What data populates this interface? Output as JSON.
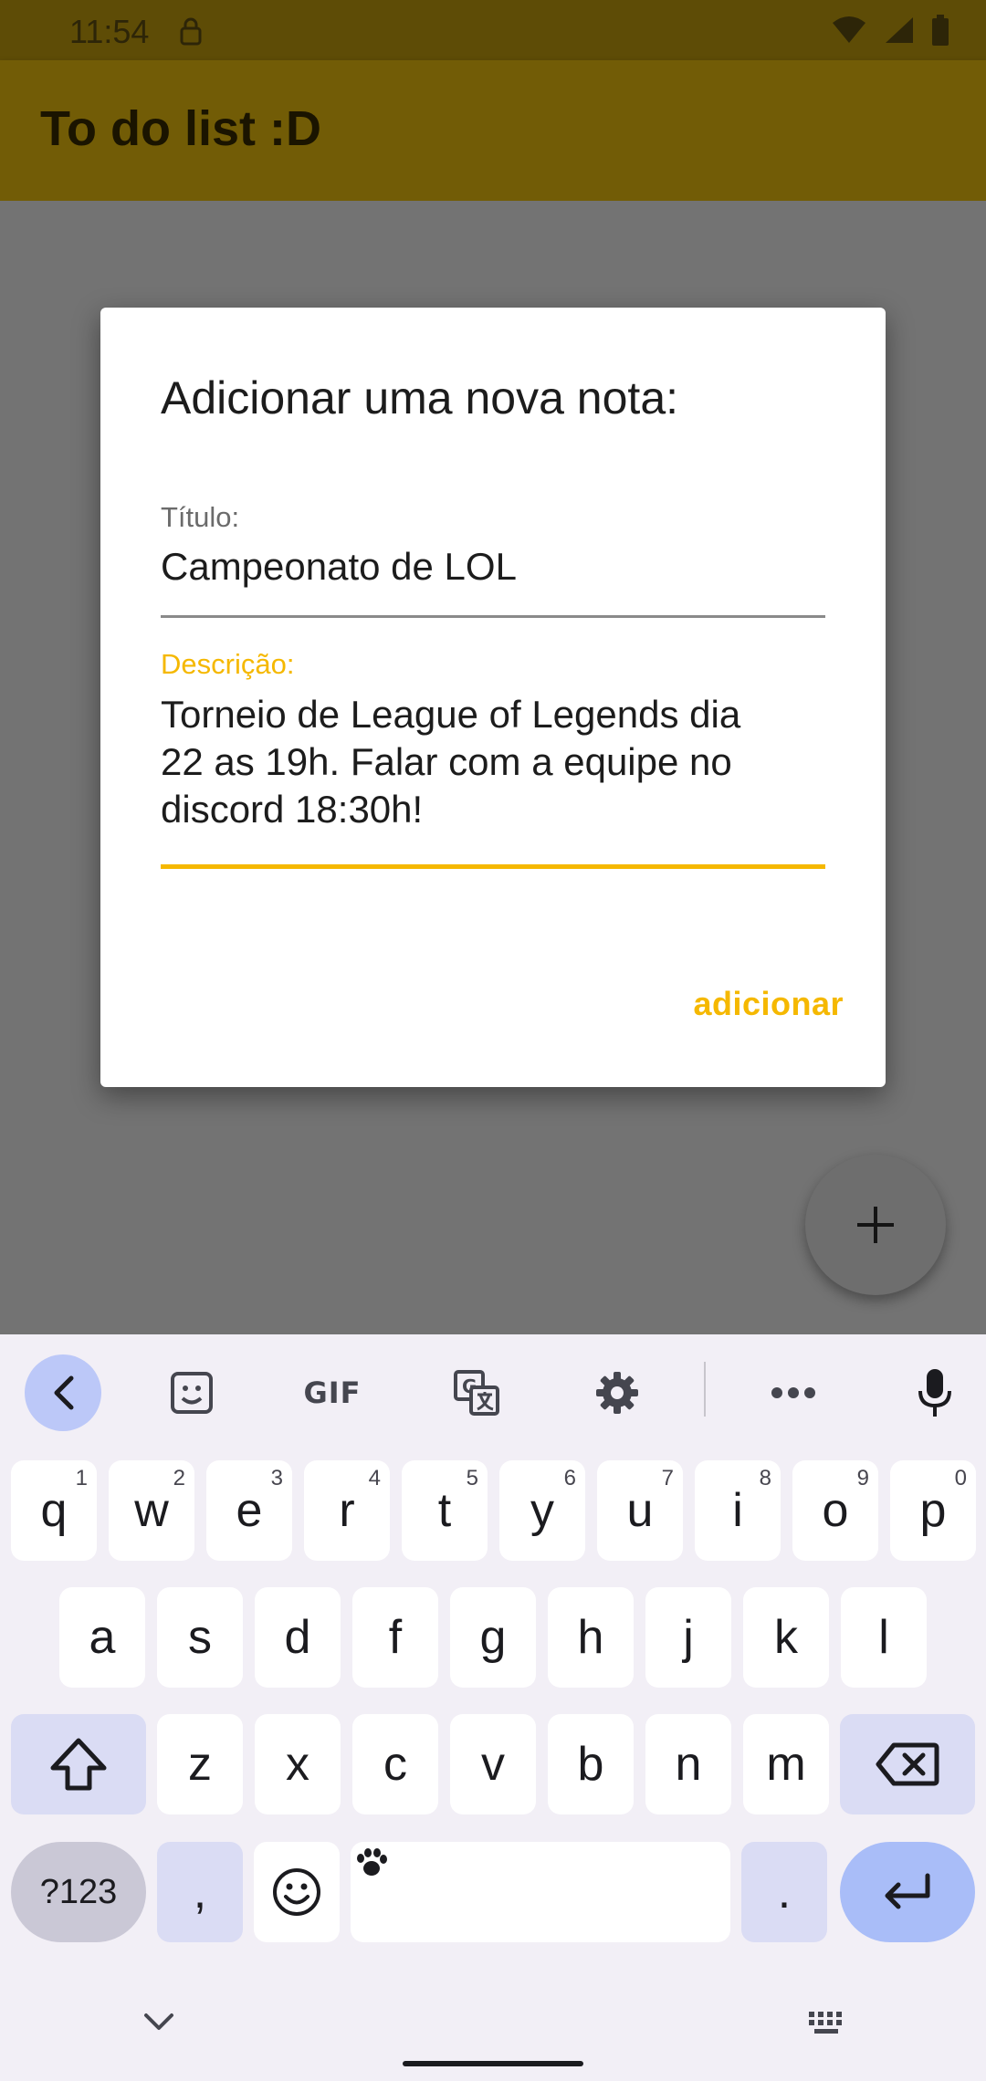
{
  "status_bar": {
    "time": "11:54"
  },
  "app_bar": {
    "title": "To do list :D"
  },
  "dialog": {
    "title": "Adicionar uma nova nota:",
    "title_label": "Título:",
    "title_value": "Campeonato de LOL",
    "description_label": "Descrição:",
    "description_value": "Torneio de League of Legends dia\n22 as 19h. Falar com a equipe no\ndiscord 18:30h!",
    "add_button": "adicionar"
  },
  "keyboard": {
    "toolbar": {
      "gif_label": "GIF"
    },
    "row1": [
      {
        "key": "q",
        "hint": "1"
      },
      {
        "key": "w",
        "hint": "2"
      },
      {
        "key": "e",
        "hint": "3"
      },
      {
        "key": "r",
        "hint": "4"
      },
      {
        "key": "t",
        "hint": "5"
      },
      {
        "key": "y",
        "hint": "6"
      },
      {
        "key": "u",
        "hint": "7"
      },
      {
        "key": "i",
        "hint": "8"
      },
      {
        "key": "o",
        "hint": "9"
      },
      {
        "key": "p",
        "hint": "0"
      }
    ],
    "row2": [
      "a",
      "s",
      "d",
      "f",
      "g",
      "h",
      "j",
      "k",
      "l"
    ],
    "row3": [
      "z",
      "x",
      "c",
      "v",
      "b",
      "n",
      "m"
    ],
    "symbols_key": "?123",
    "comma_key": ",",
    "period_key": "."
  },
  "colors": {
    "accent": "#f5b800",
    "app_bar_dimmed": "#725c06",
    "scrim_background": "#737373"
  }
}
